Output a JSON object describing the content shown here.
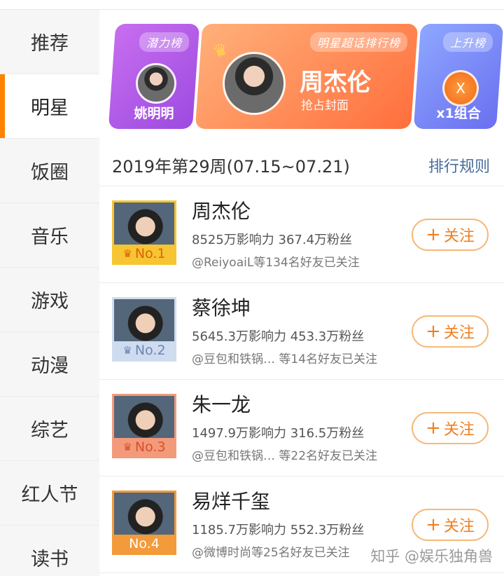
{
  "sidebar": {
    "items": [
      {
        "label": "推荐"
      },
      {
        "label": "明星"
      },
      {
        "label": "饭圈"
      },
      {
        "label": "音乐"
      },
      {
        "label": "游戏"
      },
      {
        "label": "动漫"
      },
      {
        "label": "综艺"
      },
      {
        "label": "红人节"
      },
      {
        "label": "读书"
      }
    ],
    "active_index": 1
  },
  "banner": {
    "left": {
      "tag": "潜力榜",
      "name": "姚明明"
    },
    "mid": {
      "tag": "明星超话排行榜",
      "title": "周杰伦",
      "sub": "抢占封面"
    },
    "right": {
      "tag": "上升榜",
      "badge": "X",
      "name": "x1组合"
    }
  },
  "week": {
    "text": "2019年第29周(07.15~07.21)",
    "rules": "排行规则"
  },
  "rows": [
    {
      "name": "周杰伦",
      "stats": "8525万影响力 367.4万粉丝",
      "friends": "@ReiyoaiL等134名好友已关注",
      "rank": "No.1",
      "follow": "关注",
      "rank_color": "#f7c531",
      "rank_text_color": "#e06010"
    },
    {
      "name": "蔡徐坤",
      "stats": "5645.3万影响力 453.3万粉丝",
      "friends": "@豆包和铁锅… 等14名好友已关注",
      "rank": "No.2",
      "follow": "关注",
      "rank_color": "#cfdcef",
      "rank_text_color": "#6b86b5"
    },
    {
      "name": "朱一龙",
      "stats": "1497.9万影响力 316.5万粉丝",
      "friends": "@豆包和铁锅… 等22名好友已关注",
      "rank": "No.3",
      "follow": "关注",
      "rank_color": "#f29a7a",
      "rank_text_color": "#d8502a"
    },
    {
      "name": "易烊千玺",
      "stats": "1185.7万影响力 552.3万粉丝",
      "friends": "@微博时尚等25名好友已关注",
      "rank": "No.4",
      "follow": "关注",
      "rank_color": "#f39a3a",
      "rank_text_color": "#ffffff"
    }
  ],
  "watermark": "知乎 @娱乐独角兽",
  "colors": {
    "accent": "#ff8200",
    "follow": "#f08020",
    "link": "#4a6c9c"
  }
}
